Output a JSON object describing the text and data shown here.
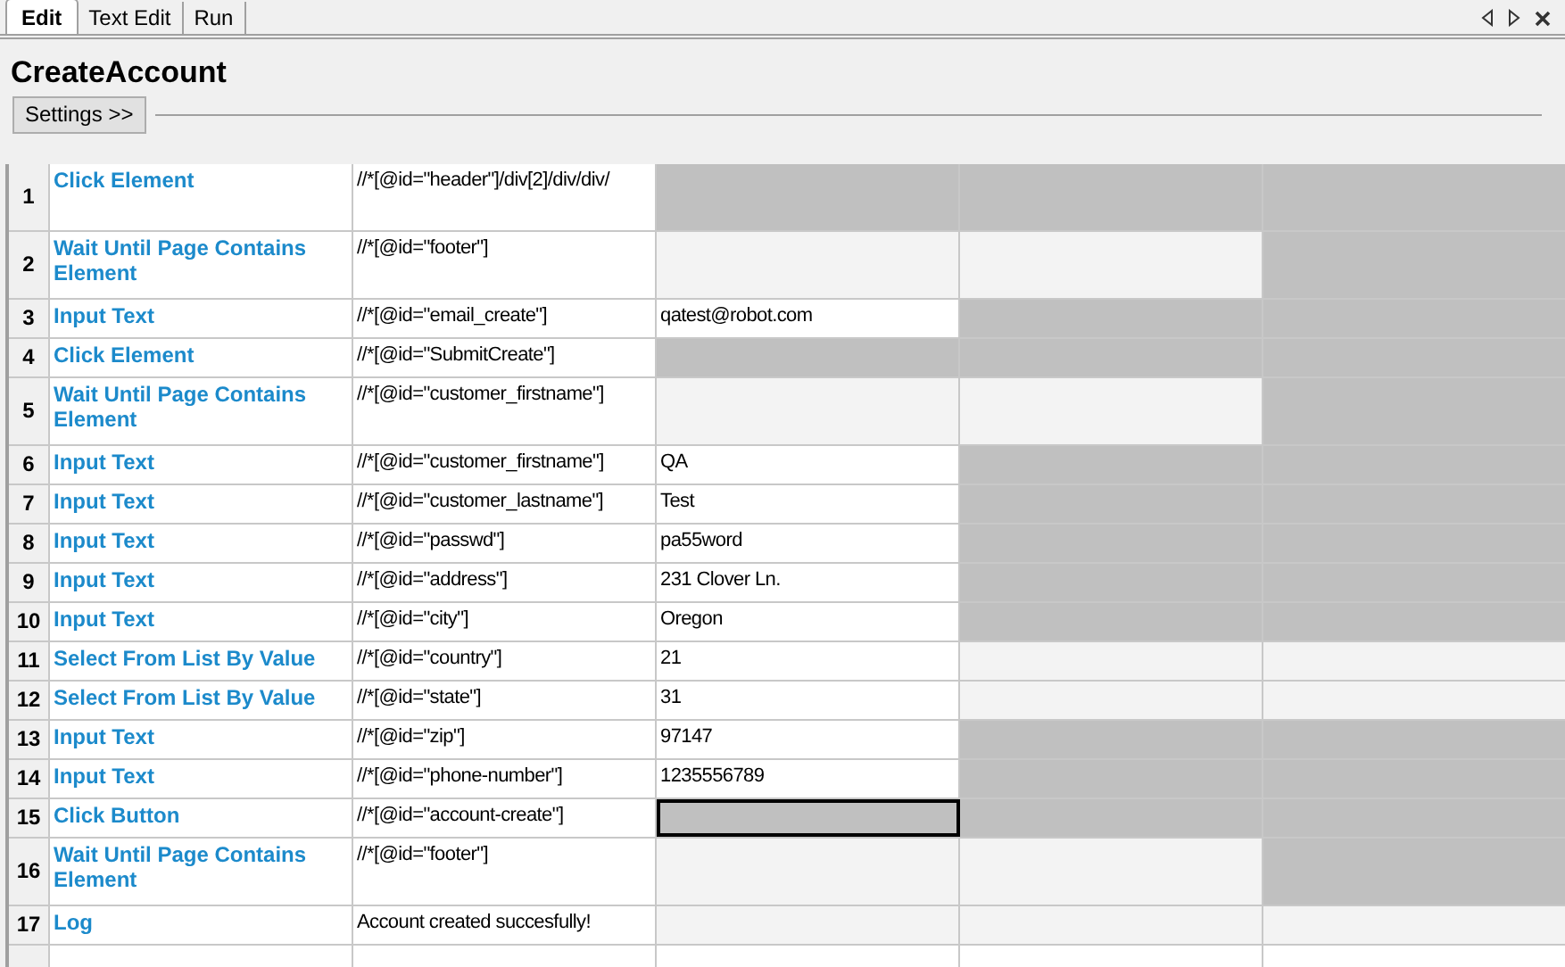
{
  "tabs": [
    {
      "label": "Edit",
      "selected": true
    },
    {
      "label": "Text Edit",
      "selected": false
    },
    {
      "label": "Run",
      "selected": false
    }
  ],
  "title": "CreateAccount",
  "settings_button": "Settings >>",
  "rows": [
    {
      "number": "1",
      "keyword": "Click Element",
      "tall": true,
      "cells": [
        {
          "kind": "text",
          "text": "//*[@id=\"header\"]/div[2]/div/div/",
          "selected": false
        },
        {
          "kind": "na",
          "selected": false
        },
        {
          "kind": "na",
          "selected": false
        },
        {
          "kind": "na",
          "selected": false
        }
      ]
    },
    {
      "number": "2",
      "keyword": "Wait Until Page Contains Element",
      "tall": true,
      "cells": [
        {
          "kind": "text",
          "text": "//*[@id=\"footer\"]",
          "selected": false
        },
        {
          "kind": "empty",
          "selected": false
        },
        {
          "kind": "empty",
          "selected": false
        },
        {
          "kind": "na",
          "selected": false
        }
      ]
    },
    {
      "number": "3",
      "keyword": "Input Text",
      "tall": false,
      "cells": [
        {
          "kind": "text",
          "text": "//*[@id=\"email_create\"]",
          "selected": false
        },
        {
          "kind": "text",
          "text": "qatest@robot.com",
          "selected": false
        },
        {
          "kind": "na",
          "selected": false
        },
        {
          "kind": "na",
          "selected": false
        }
      ]
    },
    {
      "number": "4",
      "keyword": "Click Element",
      "tall": false,
      "cells": [
        {
          "kind": "text",
          "text": "//*[@id=\"SubmitCreate\"]",
          "selected": false
        },
        {
          "kind": "na",
          "selected": false
        },
        {
          "kind": "na",
          "selected": false
        },
        {
          "kind": "na",
          "selected": false
        }
      ]
    },
    {
      "number": "5",
      "keyword": "Wait Until Page Contains Element",
      "tall": true,
      "cells": [
        {
          "kind": "text",
          "text": "//*[@id=\"customer_firstname\"]",
          "selected": false
        },
        {
          "kind": "empty",
          "selected": false
        },
        {
          "kind": "empty",
          "selected": false
        },
        {
          "kind": "na",
          "selected": false
        }
      ]
    },
    {
      "number": "6",
      "keyword": "Input Text",
      "tall": false,
      "cells": [
        {
          "kind": "text",
          "text": "//*[@id=\"customer_firstname\"]",
          "selected": false
        },
        {
          "kind": "text",
          "text": "QA",
          "selected": false
        },
        {
          "kind": "na",
          "selected": false
        },
        {
          "kind": "na",
          "selected": false
        }
      ]
    },
    {
      "number": "7",
      "keyword": "Input Text",
      "tall": false,
      "cells": [
        {
          "kind": "text",
          "text": "//*[@id=\"customer_lastname\"]",
          "selected": false
        },
        {
          "kind": "text",
          "text": "Test",
          "selected": false
        },
        {
          "kind": "na",
          "selected": false
        },
        {
          "kind": "na",
          "selected": false
        }
      ]
    },
    {
      "number": "8",
      "keyword": "Input Text",
      "tall": false,
      "cells": [
        {
          "kind": "text",
          "text": "//*[@id=\"passwd\"]",
          "selected": false
        },
        {
          "kind": "text",
          "text": "pa55word",
          "selected": false
        },
        {
          "kind": "na",
          "selected": false
        },
        {
          "kind": "na",
          "selected": false
        }
      ]
    },
    {
      "number": "9",
      "keyword": "Input Text",
      "tall": false,
      "cells": [
        {
          "kind": "text",
          "text": "//*[@id=\"address\"]",
          "selected": false
        },
        {
          "kind": "text",
          "text": "231 Clover Ln.",
          "selected": false
        },
        {
          "kind": "na",
          "selected": false
        },
        {
          "kind": "na",
          "selected": false
        }
      ]
    },
    {
      "number": "10",
      "keyword": "Input Text",
      "tall": false,
      "cells": [
        {
          "kind": "text",
          "text": "//*[@id=\"city\"]",
          "selected": false
        },
        {
          "kind": "text",
          "text": "Oregon",
          "selected": false
        },
        {
          "kind": "na",
          "selected": false
        },
        {
          "kind": "na",
          "selected": false
        }
      ]
    },
    {
      "number": "11",
      "keyword": "Select From List By Value",
      "tall": false,
      "cells": [
        {
          "kind": "text",
          "text": "//*[@id=\"country\"]",
          "selected": false
        },
        {
          "kind": "text",
          "text": "21",
          "selected": false
        },
        {
          "kind": "empty",
          "selected": false
        },
        {
          "kind": "empty",
          "selected": false
        }
      ]
    },
    {
      "number": "12",
      "keyword": "Select From List By Value",
      "tall": false,
      "cells": [
        {
          "kind": "text",
          "text": "//*[@id=\"state\"]",
          "selected": false
        },
        {
          "kind": "text",
          "text": "31",
          "selected": false
        },
        {
          "kind": "empty",
          "selected": false
        },
        {
          "kind": "empty",
          "selected": false
        }
      ]
    },
    {
      "number": "13",
      "keyword": "Input Text",
      "tall": false,
      "cells": [
        {
          "kind": "text",
          "text": "//*[@id=\"zip\"]",
          "selected": false
        },
        {
          "kind": "text",
          "text": "97147",
          "selected": false
        },
        {
          "kind": "na",
          "selected": false
        },
        {
          "kind": "na",
          "selected": false
        }
      ]
    },
    {
      "number": "14",
      "keyword": "Input Text",
      "tall": false,
      "cells": [
        {
          "kind": "text",
          "text": "//*[@id=\"phone-number\"]",
          "selected": false
        },
        {
          "kind": "text",
          "text": "1235556789",
          "selected": false
        },
        {
          "kind": "na",
          "selected": false
        },
        {
          "kind": "na",
          "selected": false
        }
      ]
    },
    {
      "number": "15",
      "keyword": "Click Button",
      "tall": false,
      "cells": [
        {
          "kind": "text",
          "text": "//*[@id=\"account-create\"]",
          "selected": false
        },
        {
          "kind": "na",
          "selected": true
        },
        {
          "kind": "na",
          "selected": false
        },
        {
          "kind": "na",
          "selected": false
        }
      ]
    },
    {
      "number": "16",
      "keyword": "Wait Until Page Contains Element",
      "tall": true,
      "cells": [
        {
          "kind": "text",
          "text": "//*[@id=\"footer\"]",
          "selected": false
        },
        {
          "kind": "empty",
          "selected": false
        },
        {
          "kind": "empty",
          "selected": false
        },
        {
          "kind": "na",
          "selected": false
        }
      ]
    },
    {
      "number": "17",
      "keyword": "Log",
      "tall": false,
      "cells": [
        {
          "kind": "text",
          "text": "Account created succesfully!",
          "selected": false
        },
        {
          "kind": "empty",
          "selected": false
        },
        {
          "kind": "empty",
          "selected": false
        },
        {
          "kind": "empty",
          "selected": false
        }
      ]
    }
  ]
}
